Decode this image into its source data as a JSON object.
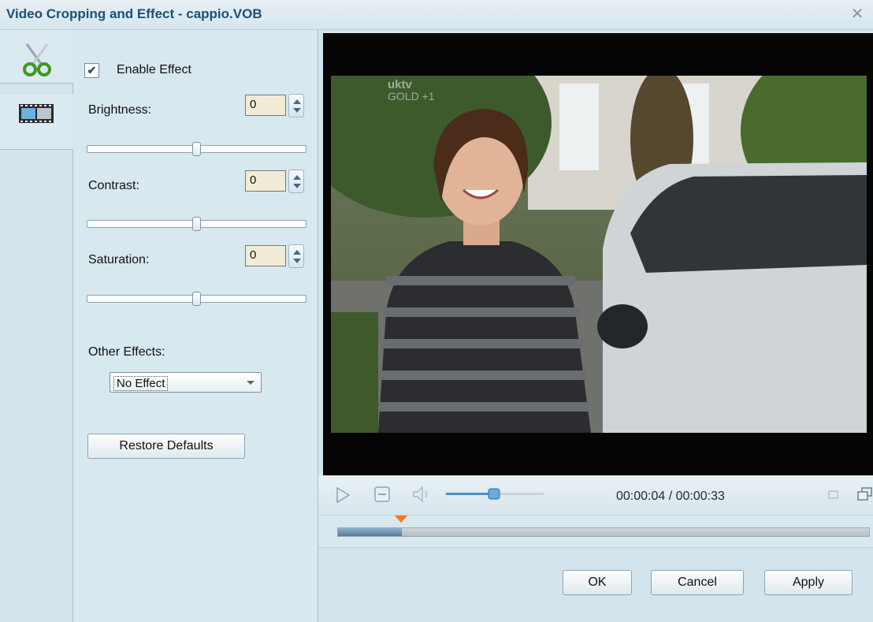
{
  "window": {
    "title": "Video Cropping and Effect - cappio.VOB",
    "close_glyph": "✕"
  },
  "tabs": [
    {
      "name": "crop",
      "icon": "scissors-icon"
    },
    {
      "name": "effect",
      "icon": "filmstrip-icon"
    }
  ],
  "effects": {
    "enable_label": "Enable Effect",
    "enabled": true,
    "brightness": {
      "label": "Brightness:",
      "value": "0",
      "level": 0.5
    },
    "contrast": {
      "label": "Contrast:",
      "value": "0",
      "level": 0.5
    },
    "saturation": {
      "label": "Saturation:",
      "value": "0",
      "level": 0.5
    },
    "other_label": "Other Effects:",
    "other_value": "No Effect",
    "restore_label": "Restore Defaults"
  },
  "preview": {
    "channel_logo": "uktv",
    "channel_sub": "GOLD +1"
  },
  "player": {
    "timecode": "00:00:04 / 00:00:33",
    "volume_level": 0.5,
    "progress": 0.12
  },
  "buttons": {
    "ok": "OK",
    "cancel": "Cancel",
    "apply": "Apply"
  }
}
